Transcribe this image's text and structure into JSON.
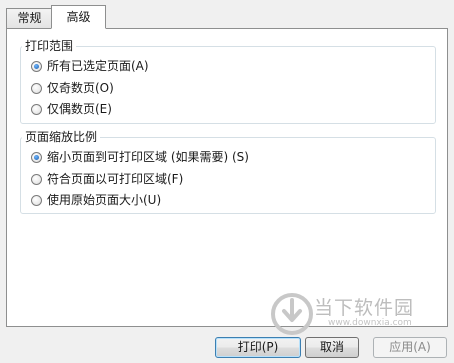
{
  "tabs": [
    {
      "label": "常规",
      "active": false
    },
    {
      "label": "高级",
      "active": true
    }
  ],
  "print_range": {
    "title": "打印范围",
    "options": [
      {
        "label": "所有已选定页面(A)",
        "checked": true
      },
      {
        "label": "仅奇数页(O)",
        "checked": false
      },
      {
        "label": "仅偶数页(E)",
        "checked": false
      }
    ]
  },
  "page_scaling": {
    "title": "页面缩放比例",
    "options": [
      {
        "label": "缩小页面到可打印区域 (如果需要) (S)",
        "checked": true
      },
      {
        "label": "符合页面以可打印区域(F)",
        "checked": false
      },
      {
        "label": "使用原始页面大小(U)",
        "checked": false
      }
    ]
  },
  "buttons": {
    "print": "打印(P)",
    "cancel": "取消",
    "apply": "应用(A)"
  },
  "watermark": {
    "name": "当下软件园",
    "url": "www.downxia.com"
  },
  "colors": {
    "accent": "#3c7fb1",
    "radio_dot": "#1a5aa8",
    "group_border": "#d5dfe5"
  }
}
